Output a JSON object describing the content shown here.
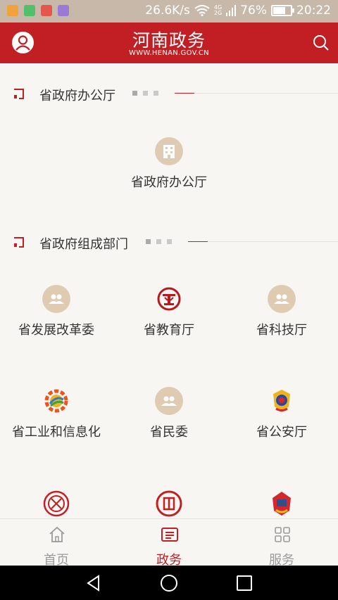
{
  "status_bar": {
    "net_speed": "26.6K/s",
    "network_badge": "4G\n2G",
    "battery": "76%",
    "battery_level": 0.76,
    "time": "20:22",
    "app_icons": [
      "app-icon-orange",
      "app-icon-green",
      "app-icon-red",
      "app-icon-purple"
    ]
  },
  "header": {
    "title": "河南政务",
    "subtitle": "WWW.HENAN.GOV.CN"
  },
  "sections": [
    {
      "title": "省政府办公厅"
    },
    {
      "title": "省政府组成部门"
    }
  ],
  "office_items": [
    {
      "label": "省政府办公厅",
      "icon": "building-icon"
    }
  ],
  "dept_items": [
    {
      "label": "省发展改革委",
      "icon": "people-icon"
    },
    {
      "label": "省教育厅",
      "icon": "education-emblem-icon"
    },
    {
      "label": "省科技厅",
      "icon": "people-icon"
    },
    {
      "label": "省工业和信息化",
      "icon": "industry-gear-icon"
    },
    {
      "label": "省民委",
      "icon": "people-icon"
    },
    {
      "label": "省公安厅",
      "icon": "police-badge-icon"
    },
    {
      "label": "",
      "icon": "red-seal-icon"
    },
    {
      "label": "",
      "icon": "justice-seal-icon"
    },
    {
      "label": "",
      "icon": "court-emblem-icon"
    }
  ],
  "tabs": [
    {
      "label": "首页",
      "icon": "home-icon",
      "active": false
    },
    {
      "label": "政务",
      "icon": "document-icon",
      "active": true
    },
    {
      "label": "服务",
      "icon": "grid-icon",
      "active": false
    }
  ],
  "colors": {
    "brand_red": "#c21f25",
    "tan": "#dfcbb2",
    "background": "#f7f6f2"
  }
}
